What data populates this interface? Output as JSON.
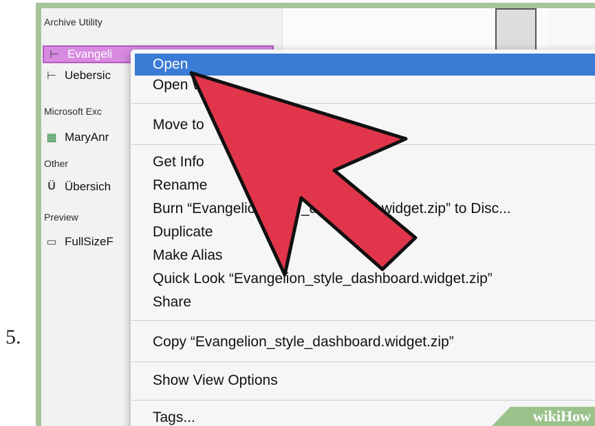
{
  "step_number": "5.",
  "sidebar": {
    "sections": [
      {
        "title": "Archive Utility",
        "items": [
          {
            "label": "Evangeli",
            "icon": "archive-icon",
            "selected": true
          },
          {
            "label": "Uebersic",
            "icon": "archive-icon"
          }
        ]
      },
      {
        "title": "Microsoft Exc",
        "items": [
          {
            "label": "MaryAnr",
            "icon": "spreadsheet-icon"
          }
        ]
      },
      {
        "title": "Other",
        "items": [
          {
            "label": "Übersich",
            "icon": "app-icon"
          }
        ]
      },
      {
        "title": "Preview",
        "items": [
          {
            "label": "FullSizeF",
            "icon": "image-icon"
          }
        ]
      }
    ]
  },
  "context_menu": {
    "items": [
      {
        "label": "Open",
        "highlighted": true
      },
      {
        "label": "Open With"
      },
      {
        "label": "Move to"
      },
      {
        "label": "Get Info"
      },
      {
        "label": "Rename"
      },
      {
        "label": "Burn “Evangelion_style_dashboard.widget.zip” to Disc..."
      },
      {
        "label": "Duplicate"
      },
      {
        "label": "Make Alias"
      },
      {
        "label": "Quick Look “Evangelion_style_dashboard.widget.zip”"
      },
      {
        "label": "Share"
      },
      {
        "label": "Copy “Evangelion_style_dashboard.widget.zip”"
      },
      {
        "label": "Show View Options"
      },
      {
        "label": "Tags..."
      }
    ]
  },
  "watermark": {
    "wiki": "wiki",
    "how": "How"
  },
  "colors": {
    "accent": "#3a7bd5",
    "selection": "#d78ae0",
    "arrow": "#e0354a",
    "frame": "#a8c59a"
  }
}
